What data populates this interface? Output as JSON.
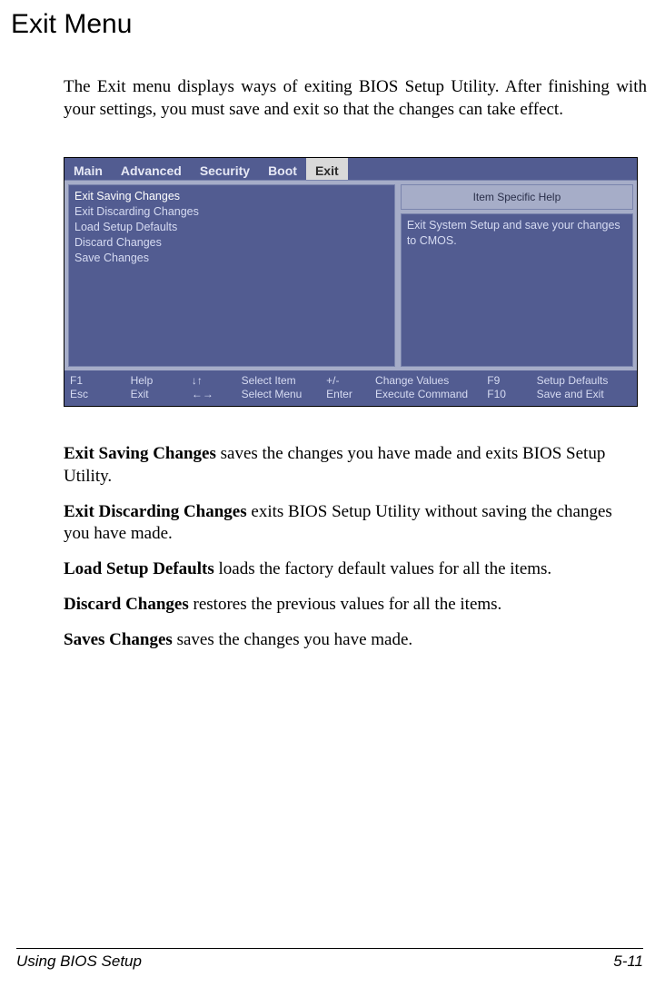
{
  "heading": "Exit Menu",
  "intro": "The Exit menu displays ways of exiting BIOS Setup Utility. After finishing with your settings, you must save and exit so that the changes can take effect.",
  "bios": {
    "tabs": [
      "Main",
      "Advanced",
      "Security",
      "Boot",
      "Exit"
    ],
    "active_tab": "Exit",
    "menu_items": [
      "Exit Saving Changes",
      "Exit Discarding Changes",
      "Load Setup Defaults",
      "Discard Changes",
      "Save Changes"
    ],
    "help_title": "Item Specific Help",
    "help_body": "Exit System Setup and save your changes to CMOS.",
    "footer": [
      {
        "key": "F1",
        "label": "Help"
      },
      {
        "key": "Esc",
        "label": "Exit"
      },
      {
        "key": "↓↑",
        "label": "Select Item"
      },
      {
        "key": "←→",
        "label": "Select Menu"
      },
      {
        "key": "+/-",
        "label": "Change Values"
      },
      {
        "key": "Enter",
        "label": "Execute Command"
      },
      {
        "key": "F9",
        "label": "Setup Defaults"
      },
      {
        "key": "F10",
        "label": "Save and Exit"
      }
    ]
  },
  "descriptions": [
    {
      "term": "Exit Saving Changes",
      "text": "  saves the changes you have made and exits BIOS Setup Utility."
    },
    {
      "term": "Exit Discarding Changes",
      "text": "  exits BIOS Setup Utility without saving the changes you have made."
    },
    {
      "term": "Load Setup Defaults",
      "text": "  loads the factory default values for all the items."
    },
    {
      "term": "Discard Changes",
      "text": "  restores the previous values for all the items."
    },
    {
      "term": "Saves Changes",
      "text": "  saves the changes you have made."
    }
  ],
  "footer": {
    "left": "Using BIOS Setup",
    "right": "5-11"
  }
}
